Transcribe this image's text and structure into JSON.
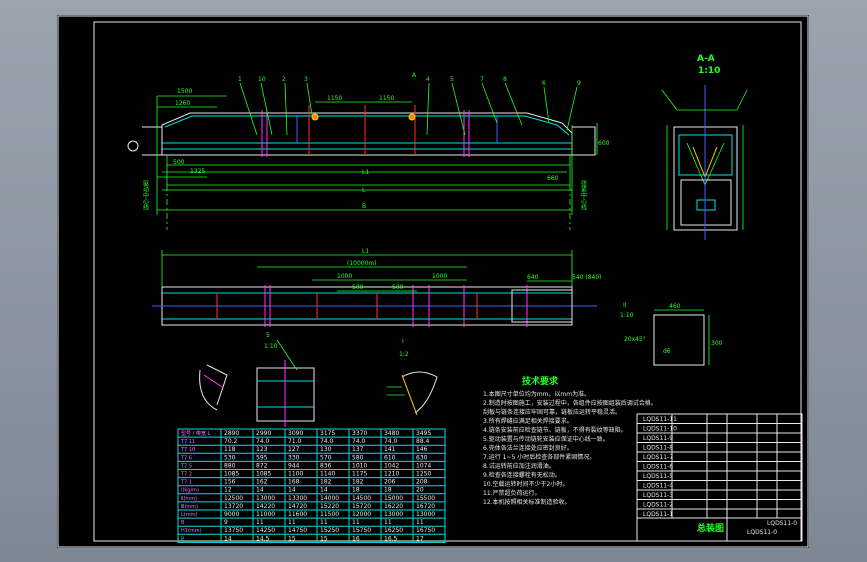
{
  "section": {
    "title": "A-A",
    "scale": "1:10"
  },
  "detail_i": {
    "label": "II",
    "scale": "1:10",
    "dim_top": "460",
    "dim_side": "300",
    "chamfer": "20x45°",
    "mark": "d6"
  },
  "detail_5": {
    "label": "5",
    "scale": "1:10"
  },
  "detail_small": {
    "label": "I",
    "scale": "1:2"
  },
  "tech_title": "技术要求",
  "elevation": {
    "dims_top": [
      "1500",
      "1260",
      "1150",
      "1150"
    ],
    "dims_side": [
      "500",
      "660",
      "600"
    ],
    "dims_bottom": [
      "1325",
      "L1",
      "L",
      "B"
    ],
    "balloons": [
      "1",
      "10",
      "2",
      "3",
      "4",
      "5",
      "7",
      "8",
      "6",
      "9",
      "A"
    ],
    "center_left": "驱动中心线",
    "center_right": "张紧中心线"
  },
  "plan": {
    "dims": [
      "L1",
      "(10000m)",
      "1000",
      "1000",
      "500",
      "500",
      "640",
      "540 (840)"
    ]
  },
  "table": {
    "header": [
      "型号 / 带宽 L",
      "2890",
      "2990",
      "3090",
      "3175",
      "3370",
      "3480",
      "3495"
    ],
    "rows": [
      [
        "T7  11",
        "70.2",
        "74.0",
        "71.0",
        "74.0",
        "74.0",
        "74.0",
        "88.4"
      ],
      [
        "T7  10",
        "118",
        "123",
        "127",
        "130",
        "137",
        "141",
        "146"
      ],
      [
        "T7  6",
        "530",
        "595",
        "330",
        "570",
        "580",
        "610",
        "630"
      ],
      [
        "T7  5",
        "880",
        "872",
        "944",
        "836",
        "1010",
        "1042",
        "1074"
      ],
      [
        "T7  2",
        "1085",
        "1085",
        "1100",
        "1140",
        "1175",
        "1210",
        "1250"
      ],
      [
        "T7  1",
        "156",
        "162",
        "168",
        "182",
        "182",
        "206",
        "208"
      ],
      [
        "I(kg/m)",
        "12",
        "14",
        "14",
        "14",
        "18",
        "18",
        "20"
      ],
      [
        "Ⅱ(mm)",
        "12500",
        "13000",
        "13300",
        "14000",
        "14500",
        "15000",
        "15500"
      ],
      [
        "Ⅲ(mm)",
        "13720",
        "14220",
        "14720",
        "15220",
        "15720",
        "16220",
        "16720"
      ],
      [
        "L(mm)",
        "9000",
        "11000",
        "11600",
        "11500",
        "12000",
        "13000",
        "13000"
      ],
      [
        "B",
        "9",
        "11",
        "11",
        "11",
        "11",
        "11",
        "11"
      ],
      [
        "H1(mm)",
        "13750",
        "14250",
        "14750",
        "15250",
        "15750",
        "16250",
        "16750"
      ],
      [
        "P",
        "14",
        "14.5",
        "15",
        "15",
        "16",
        "16.5",
        "17"
      ]
    ]
  },
  "notes": [
    "1.本图尺寸单位均为mm，以mm为准。",
    "2.制造时按图施工，安装过程中，各组件应按图组装后调试合格。",
    "  刮板与链条连接应牢固可靠，链板应运转平稳灵活。",
    "3.所有焊缝应满足相关焊接要求。",
    "4.链条安装前应检查链节、链板，不得有裂纹等缺陷。",
    "5.驱动装置与传动链轮安装应保证中心线一致。",
    "6.壳体各法兰连接处应密封良好。",
    "7.运行 1~5 小时后检查各部件紧固情况。",
    "8.试运转前应加注润滑油。",
    "9.检查各连接螺栓有无松动。",
    "10.空载运转时间不少于2小时。",
    "11.严禁超负荷运行。",
    "12.本机按照相关标准制造验收。"
  ],
  "title_block": {
    "name": "总装图",
    "code": "LQDS11-0",
    "spec": "LQDS11-0",
    "parts": [
      "LQDS11-11",
      "LQDS11-10",
      "LQDS11-9",
      "LQDS11-8",
      "LQDS11-7",
      "LQDS11-6",
      "LQDS11-5",
      "LQDS11-4",
      "LQDS11-3",
      "LQDS11-2",
      "LQDS11-1"
    ]
  }
}
